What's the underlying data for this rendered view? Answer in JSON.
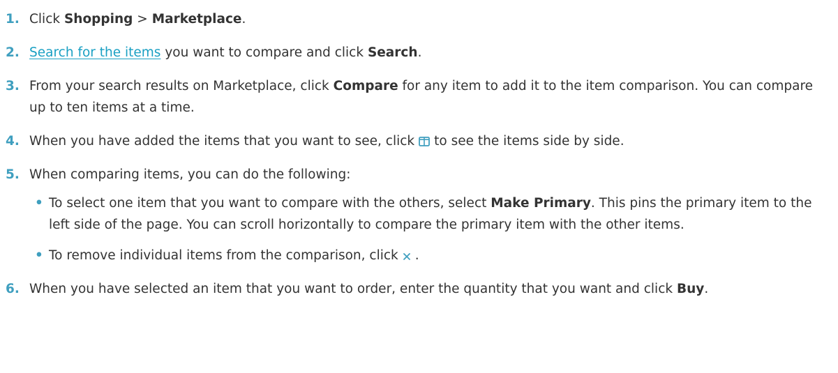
{
  "colors": {
    "accent": "#3f9fbf",
    "link": "#1aa0c3",
    "text": "#333333"
  },
  "steps": [
    {
      "num": "1.",
      "t1": "Click ",
      "b1": "Shopping",
      "t2": " > ",
      "b2": "Marketplace",
      "t3": "."
    },
    {
      "num": "2.",
      "link": "Search for the items",
      "t1": " you want to compare and click ",
      "b1": "Search",
      "t2": "."
    },
    {
      "num": "3.",
      "t1": "From your search results on Marketplace, click ",
      "b1": "Compare",
      "t2": " for any item to add it to the item comparison. You can compare up to ten items at a time."
    },
    {
      "num": "4.",
      "t1": "When you have added the items that you want to see, click",
      "icon": "compare-columns-icon",
      "t2": "to see the items side by side."
    },
    {
      "num": "5.",
      "t1": "When comparing items, you can do the following:",
      "bullets": [
        {
          "t1": "To select one item that you want to compare with the others, select ",
          "b1": "Make Primary",
          "t2": ". This pins the primary item to the left side of the page. You can scroll horizontally to compare the primary item with the other items."
        },
        {
          "t1": "To remove individual items from the comparison, click",
          "icon": "close-icon",
          "t2": "."
        }
      ]
    },
    {
      "num": "6.",
      "t1": "When you have selected an item that you want to order, enter the quantity that you want and click ",
      "b1": "Buy",
      "t2": "."
    }
  ]
}
